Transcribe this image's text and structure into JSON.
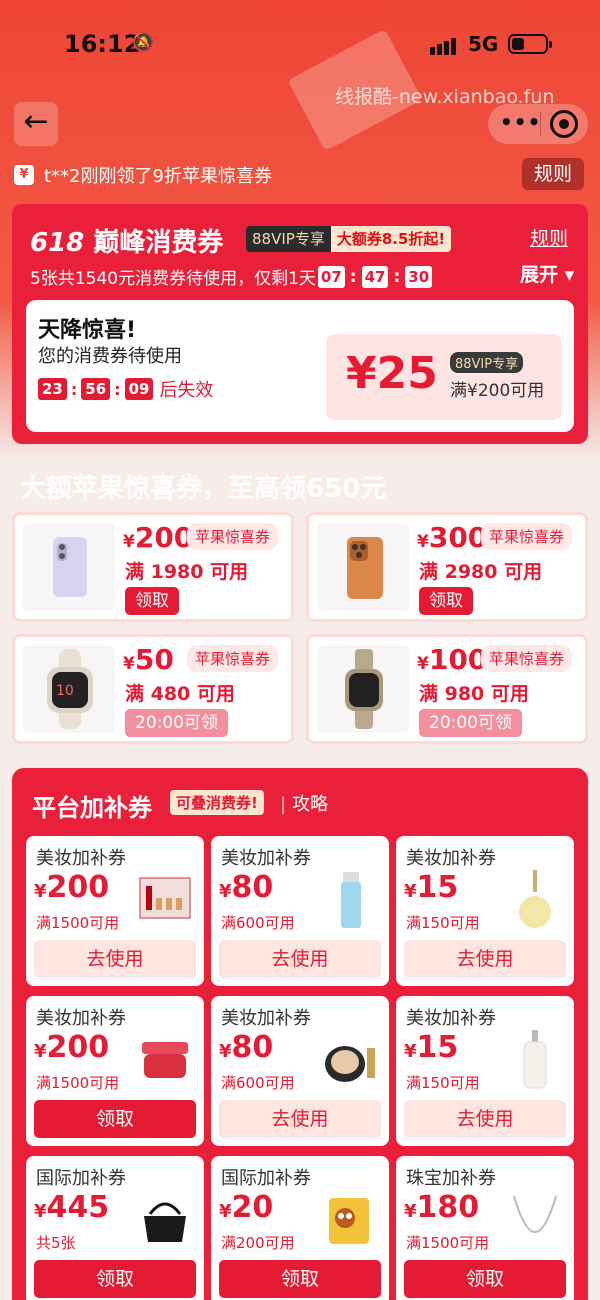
{
  "status_bar": {
    "time": "16:12",
    "network": "5G"
  },
  "watermark": "线报酷-new.xianbao.fun",
  "notice": {
    "text": "t**2刚刚领了9折苹果惊喜券",
    "rules": "规则"
  },
  "card618": {
    "title_num": "618",
    "title": "巅峰消费券",
    "vip_tag": "88VIP专享",
    "big_tag": "大额券8.5折起!",
    "rules": "规则",
    "expand": "展开",
    "sub": "5张共1540元消费券待使用，仅剩1天",
    "countdown": [
      "07",
      "47",
      "30"
    ],
    "surprise": {
      "heading": "天降惊喜!",
      "desc": "您的消费券待使用",
      "countdown": [
        "23",
        "56",
        "09"
      ],
      "expire": "后失效",
      "amount": "¥25",
      "tag": "88VIP专享",
      "cond": "满¥200可用"
    }
  },
  "apple_section": {
    "title": "大额苹果惊喜券，至高领650元",
    "items": [
      {
        "currency": "¥",
        "amount": "200",
        "tag": "苹果惊喜券",
        "cond": "满 1980 可用",
        "button": "领取"
      },
      {
        "currency": "¥",
        "amount": "300",
        "tag": "苹果惊喜券",
        "cond": "满 2980 可用",
        "button": "领取"
      },
      {
        "currency": "¥",
        "amount": "50",
        "tag": "苹果惊喜券",
        "cond": "满 480 可用",
        "button": "20:00可领"
      },
      {
        "currency": "¥",
        "amount": "100",
        "tag": "苹果惊喜券",
        "cond": "满 980 可用",
        "button": "20:00可领"
      }
    ]
  },
  "platform": {
    "title": "平台加补券",
    "tag": "可叠消费券!",
    "guide": "攻略",
    "items": [
      {
        "name": "美妆加补券",
        "currency": "¥",
        "amount": "200",
        "cond": "满1500可用",
        "button": "去使用"
      },
      {
        "name": "美妆加补券",
        "currency": "¥",
        "amount": "80",
        "cond": "满600可用",
        "button": "去使用"
      },
      {
        "name": "美妆加补券",
        "currency": "¥",
        "amount": "15",
        "cond": "满150可用",
        "button": "去使用"
      },
      {
        "name": "美妆加补券",
        "currency": "¥",
        "amount": "200",
        "cond": "满1500可用",
        "button": "领取"
      },
      {
        "name": "美妆加补券",
        "currency": "¥",
        "amount": "80",
        "cond": "满600可用",
        "button": "去使用"
      },
      {
        "name": "美妆加补券",
        "currency": "¥",
        "amount": "15",
        "cond": "满150可用",
        "button": "去使用"
      },
      {
        "name": "国际加补券",
        "currency": "¥",
        "amount": "445",
        "cond": "共5张",
        "button": "领取"
      },
      {
        "name": "国际加补券",
        "currency": "¥",
        "amount": "20",
        "cond": "满200可用",
        "button": "领取"
      },
      {
        "name": "珠宝加补券",
        "currency": "¥",
        "amount": "180",
        "cond": "满1500可用",
        "button": "领取"
      }
    ]
  },
  "colors": {
    "accent": "#e51b34",
    "header_bg": "#ee4536"
  }
}
